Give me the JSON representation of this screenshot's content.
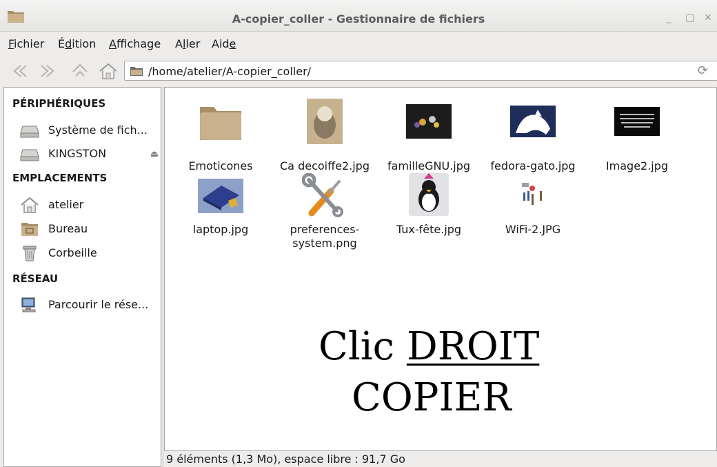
{
  "window": {
    "title": "A-copier_coller - Gestionnaire de fichiers",
    "minimize": "_",
    "maximize": "□",
    "close": "✕"
  },
  "menu": [
    {
      "mnemonic": "F",
      "rest": "ichier"
    },
    {
      "prefix": "É",
      "mnemonic": "d",
      "rest": "ition"
    },
    {
      "mnemonic": "A",
      "rest": "ffichage"
    },
    {
      "prefix": "A",
      "mnemonic": "l",
      "rest": "ler"
    },
    {
      "prefix": "Aid",
      "mnemonic": "e",
      "rest": ""
    }
  ],
  "toolbar": {
    "back_icon": "back-icon",
    "forward_icon": "forward-icon",
    "up_icon": "up-icon",
    "home_icon": "home-icon"
  },
  "location": {
    "path": "/home/atelier/A-copier_coller/"
  },
  "sidebar": {
    "devices_heading": "PÉRIPHÉRIQUES",
    "devices": [
      {
        "label": "Système de fich...",
        "icon": "drive-icon"
      },
      {
        "label": "KINGSTON",
        "icon": "usb-drive-icon",
        "eject": "⏏"
      }
    ],
    "places_heading": "EMPLACEMENTS",
    "places": [
      {
        "label": "atelier",
        "icon": "home-icon"
      },
      {
        "label": "Bureau",
        "icon": "desktop-folder-icon"
      },
      {
        "label": "Corbeille",
        "icon": "trash-icon"
      }
    ],
    "network_heading": "RÉSEAU",
    "network": [
      {
        "label": "Parcourir le rése...",
        "icon": "network-icon"
      }
    ]
  },
  "files": [
    {
      "name": "Emoticones",
      "icon": "folder-icon"
    },
    {
      "name": "Ca decoiffe2.jpg",
      "icon": "image-thumbnail-icon"
    },
    {
      "name": "familleGNU.jpg",
      "icon": "image-thumbnail-icon"
    },
    {
      "name": "fedora-gato.jpg",
      "icon": "image-thumbnail-icon"
    },
    {
      "name": "Image2.jpg",
      "icon": "image-thumbnail-icon"
    },
    {
      "name": "laptop.jpg",
      "icon": "image-thumbnail-icon"
    },
    {
      "name": "preferences-\nsystem.png",
      "icon": "tools-icon"
    },
    {
      "name": "Tux-fête.jpg",
      "icon": "image-thumbnail-icon"
    },
    {
      "name": "WiFi-2.JPG",
      "icon": "image-thumbnail-icon"
    }
  ],
  "overlay": {
    "line1_prefix": "Clic ",
    "line1_underlined": "DROIT",
    "line2": "COPIER"
  },
  "status": {
    "text": "9 éléments (1,3 Mo), espace libre : 91,7 Go"
  },
  "colors": {
    "folder": "#c9b18c",
    "folder_dark": "#a98e67",
    "panel_border": "#a9a8a5",
    "chrome_bg": "#edeceb"
  }
}
